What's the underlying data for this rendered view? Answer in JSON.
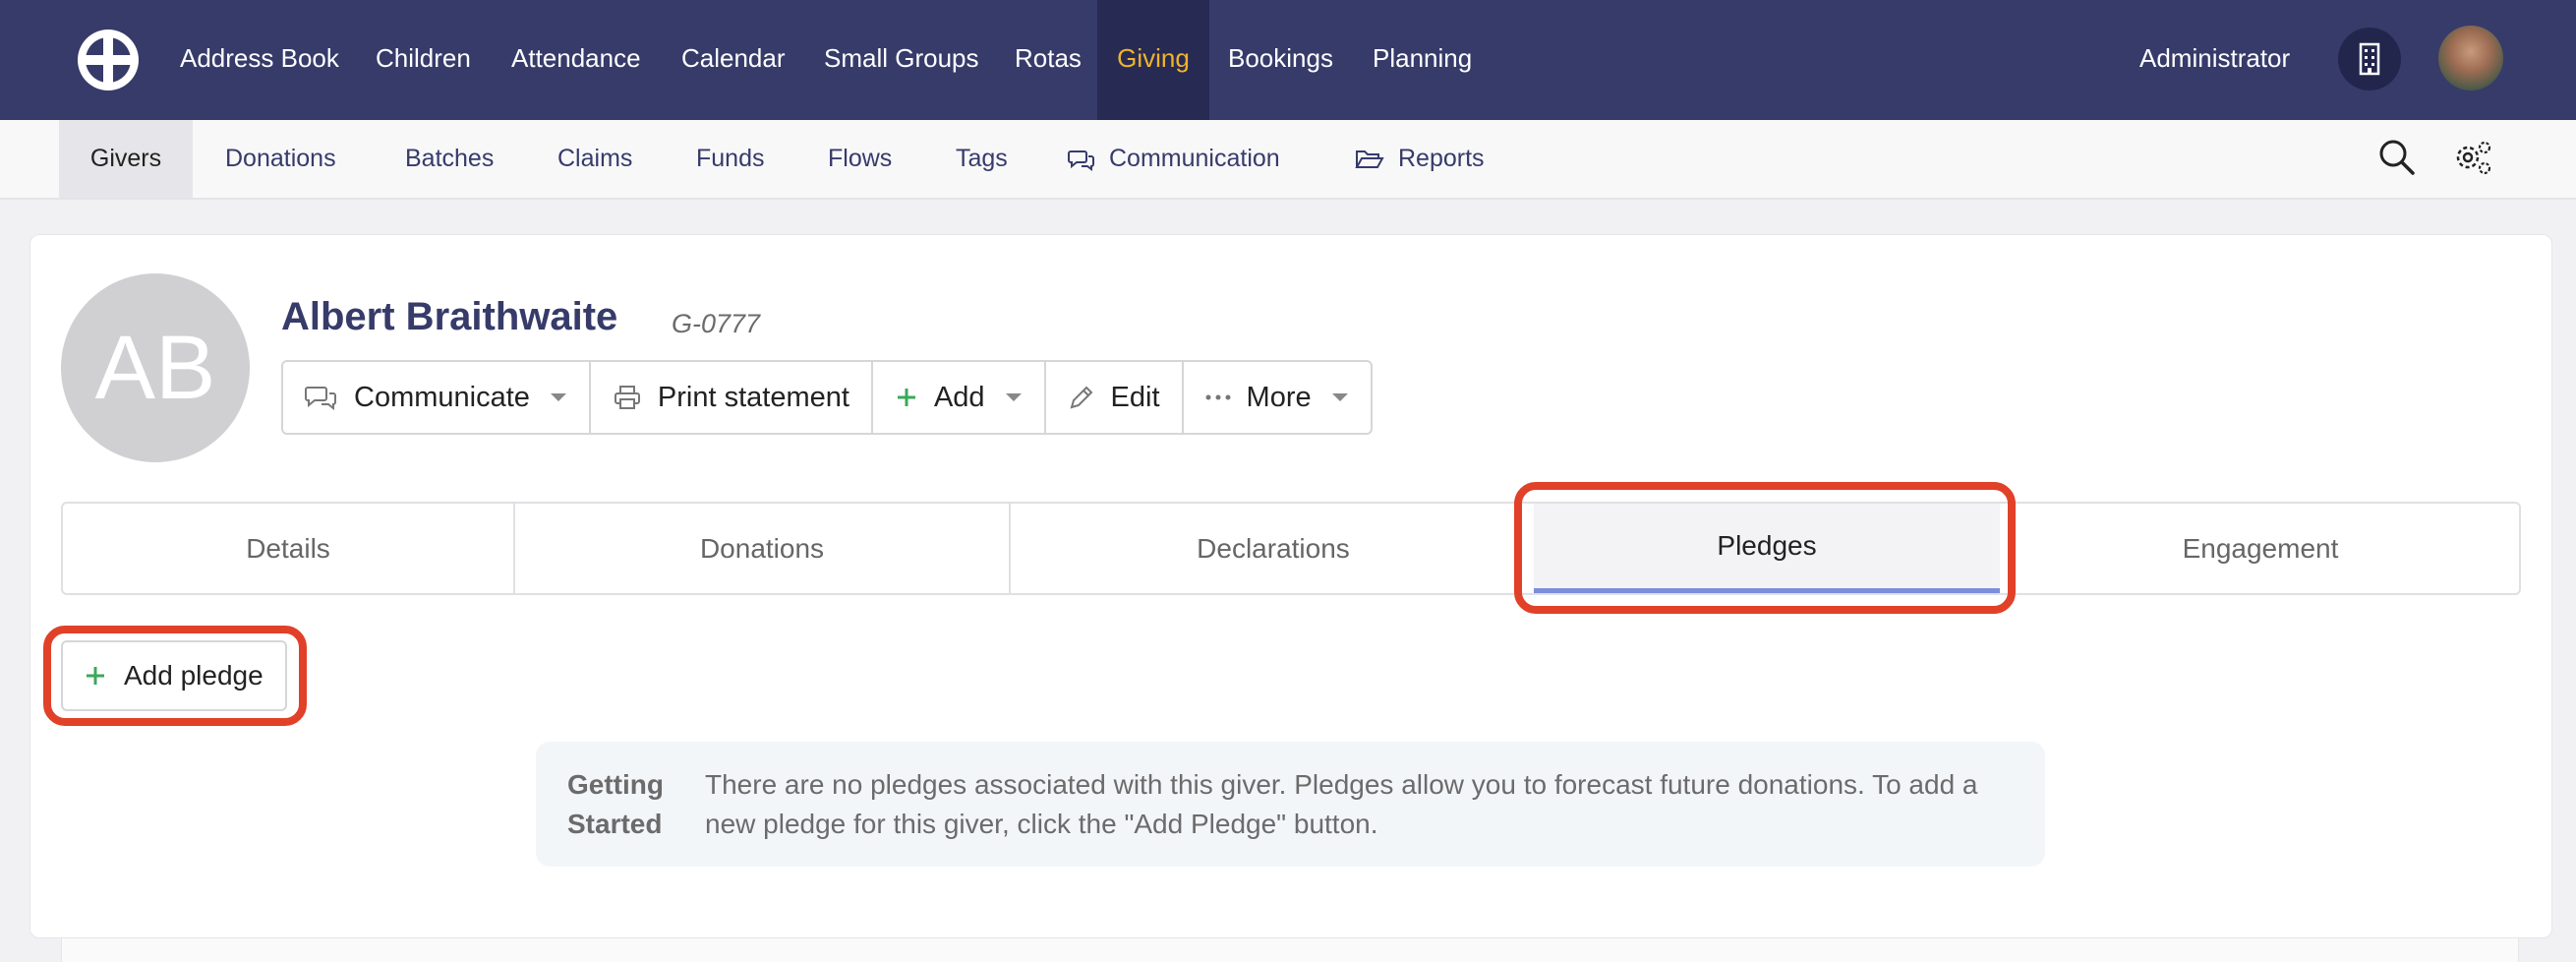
{
  "topnav": {
    "items": [
      "Address Book",
      "Children",
      "Attendance",
      "Calendar",
      "Small Groups",
      "Rotas",
      "Giving",
      "Bookings",
      "Planning"
    ],
    "active": "Giving",
    "user_label": "Administrator",
    "colors": {
      "bar": "#363b6a",
      "active_bg": "#272b54",
      "active_text": "#f0b429"
    }
  },
  "subnav": {
    "items": [
      "Givers",
      "Donations",
      "Batches",
      "Claims",
      "Funds",
      "Flows",
      "Tags",
      "Communication",
      "Reports"
    ],
    "active": "Givers",
    "icons": {
      "Communication": "chat-bubbles-icon",
      "Reports": "folder-open-icon"
    },
    "right_icons": [
      "search-icon",
      "settings-gear-icon"
    ]
  },
  "profile": {
    "initials": "AB",
    "name": "Albert Braithwaite",
    "ref": "G-0777",
    "actions": [
      {
        "label": "Communicate",
        "icon": "chat-bubbles-icon",
        "dropdown": true
      },
      {
        "label": "Print statement",
        "icon": "printer-icon",
        "dropdown": false
      },
      {
        "label": "Add",
        "icon": "plus-icon",
        "dropdown": true
      },
      {
        "label": "Edit",
        "icon": "pencil-icon",
        "dropdown": false
      },
      {
        "label": "More",
        "icon": "ellipsis-icon",
        "dropdown": true
      }
    ]
  },
  "tabs": {
    "items": [
      "Details",
      "Donations",
      "Declarations",
      "Pledges",
      "Engagement"
    ],
    "active": "Pledges"
  },
  "pledges": {
    "add_button": "Add pledge",
    "info_title": "Getting Started",
    "info_text": "There are no pledges associated with this giver. Pledges allow you to forecast future donations. To add a new pledge for this giver, click the \"Add Pledge\" button."
  },
  "highlight_color": "#e04128"
}
